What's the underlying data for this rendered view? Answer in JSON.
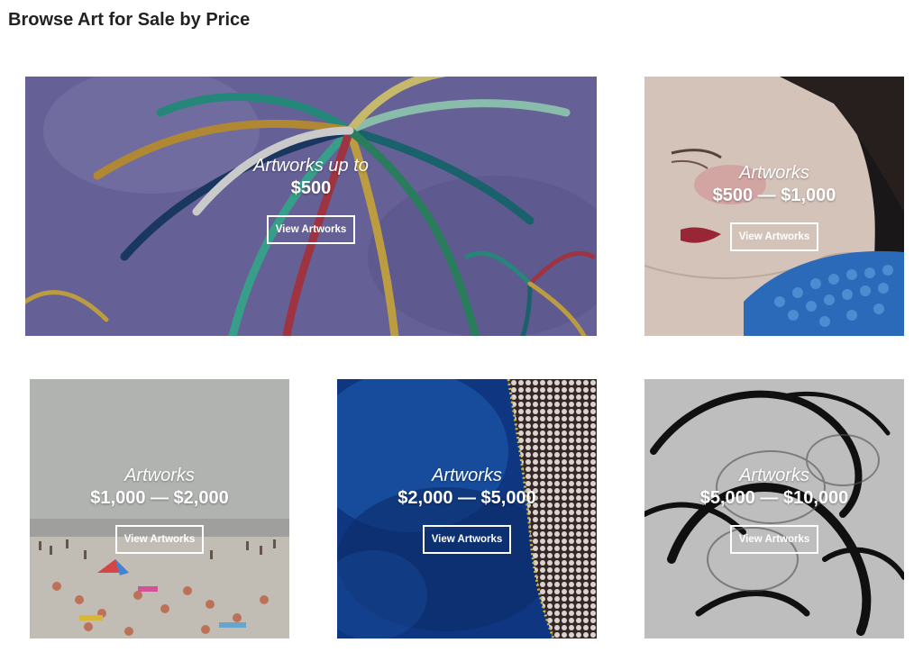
{
  "page": {
    "title": "Browse Art for Sale by Price"
  },
  "tiles": [
    {
      "line1": "Artworks up to",
      "line2": "$500",
      "button": "View Artworks"
    },
    {
      "line1": "Artworks",
      "line2": "$500 — $1,000",
      "button": "View Artworks"
    },
    {
      "line1": "Artworks",
      "line2": "$1,000 — $2,000",
      "button": "View Artworks"
    },
    {
      "line1": "Artworks",
      "line2": "$2,000 — $5,000",
      "button": "View Artworks"
    },
    {
      "line1": "Artworks",
      "line2": "$5,000 — $10,000",
      "button": "View Artworks"
    }
  ]
}
